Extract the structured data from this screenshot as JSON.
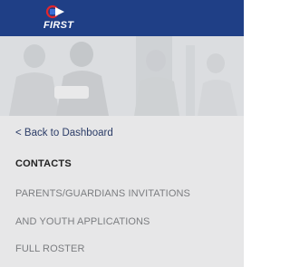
{
  "header": {
    "logo_text": "FIRST",
    "logo_icon": "first-logo-icon",
    "background_color": "#1f3f86"
  },
  "hero": {
    "image": "team-photo-banner"
  },
  "nav": {
    "back_link": "< Back to Dashboard",
    "items": [
      {
        "label": "CONTACTS",
        "active": true
      },
      {
        "label": "PARENTS/GUARDIANS INVITATIONS",
        "active": false
      },
      {
        "label": "AND YOUTH APPLICATIONS",
        "active": false
      },
      {
        "label": "FULL ROSTER",
        "active": false
      }
    ],
    "active_color": "#222222",
    "inactive_color": "#7b7d80",
    "background_color": "#e7e7e8"
  }
}
